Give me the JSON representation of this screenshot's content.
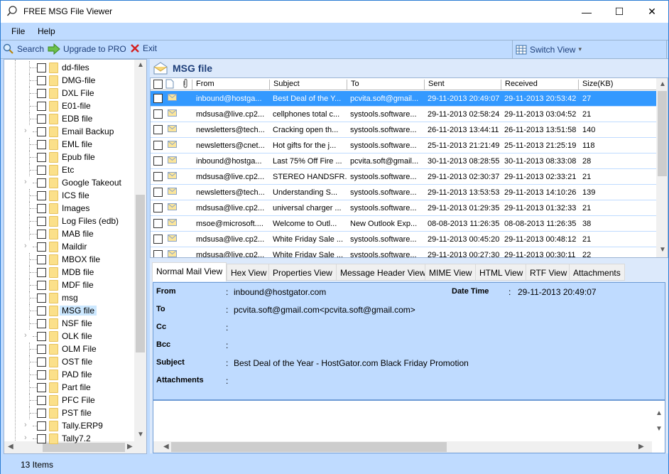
{
  "window": {
    "title": "FREE MSG File Viewer",
    "controls": {
      "minimize": "—",
      "maximize": "☐",
      "close": "✕"
    }
  },
  "menu": {
    "file": "File",
    "help": "Help"
  },
  "toolbar": {
    "search": "Search",
    "upgrade": "Upgrade to PRO",
    "exit": "Exit",
    "switch_view": "Switch View",
    "switch_view_caret": "▾"
  },
  "tree": {
    "items": [
      {
        "label": "dd-files",
        "expandable": false
      },
      {
        "label": "DMG-file",
        "expandable": false
      },
      {
        "label": "DXL File",
        "expandable": false
      },
      {
        "label": "E01-file",
        "expandable": false
      },
      {
        "label": "EDB file",
        "expandable": false
      },
      {
        "label": "Email Backup",
        "expandable": true
      },
      {
        "label": "EML file",
        "expandable": false
      },
      {
        "label": "Epub file",
        "expandable": false
      },
      {
        "label": "Etc",
        "expandable": false
      },
      {
        "label": "Google Takeout",
        "expandable": true
      },
      {
        "label": "ICS file",
        "expandable": false
      },
      {
        "label": "Images",
        "expandable": false
      },
      {
        "label": "Log Files (edb)",
        "expandable": false
      },
      {
        "label": "MAB file",
        "expandable": false
      },
      {
        "label": "Maildir",
        "expandable": true
      },
      {
        "label": "MBOX file",
        "expandable": false
      },
      {
        "label": "MDB file",
        "expandable": false
      },
      {
        "label": "MDF file",
        "expandable": false
      },
      {
        "label": "msg",
        "expandable": false
      },
      {
        "label": "MSG file",
        "expandable": false,
        "selected": true
      },
      {
        "label": "NSF file",
        "expandable": false
      },
      {
        "label": "OLK file",
        "expandable": true
      },
      {
        "label": "OLM File",
        "expandable": false
      },
      {
        "label": "OST file",
        "expandable": false
      },
      {
        "label": "PAD file",
        "expandable": false
      },
      {
        "label": "Part file",
        "expandable": false
      },
      {
        "label": "PFC File",
        "expandable": false
      },
      {
        "label": "PST file",
        "expandable": false
      },
      {
        "label": "Tally.ERP9",
        "expandable": true
      },
      {
        "label": "Tally7.2",
        "expandable": true
      }
    ]
  },
  "folder_header": {
    "title": "MSG file"
  },
  "grid": {
    "columns": [
      "From",
      "Subject",
      "To",
      "Sent",
      "Received",
      "Size(KB)"
    ],
    "rows": [
      {
        "from": "inbound@hostga...",
        "subject": "Best Deal of the Y...",
        "to": "pcvita.soft@gmail...",
        "sent": "29-11-2013 20:49:07",
        "received": "29-11-2013 20:53:42",
        "size": "27",
        "selected": true
      },
      {
        "from": "mdsusa@live.cp2...",
        "subject": "cellphones total c...",
        "to": "systools.software...",
        "sent": "29-11-2013 02:58:24",
        "received": "29-11-2013 03:04:52",
        "size": "21"
      },
      {
        "from": "newsletters@tech...",
        "subject": "Cracking open th...",
        "to": "systools.software...",
        "sent": "26-11-2013 13:44:11",
        "received": "26-11-2013 13:51:58",
        "size": "140"
      },
      {
        "from": "newsletters@cnet...",
        "subject": "Hot gifts for the j...",
        "to": "systools.software...",
        "sent": "25-11-2013 21:21:49",
        "received": "25-11-2013 21:25:19",
        "size": "118"
      },
      {
        "from": "inbound@hostga...",
        "subject": "Last 75% Off Fire ...",
        "to": "pcvita.soft@gmail...",
        "sent": "30-11-2013 08:28:55",
        "received": "30-11-2013 08:33:08",
        "size": "28"
      },
      {
        "from": "mdsusa@live.cp2...",
        "subject": "STEREO HANDSFR...",
        "to": "systools.software...",
        "sent": "29-11-2013 02:30:37",
        "received": "29-11-2013 02:33:21",
        "size": "21"
      },
      {
        "from": "newsletters@tech...",
        "subject": "Understanding S...",
        "to": "systools.software...",
        "sent": "29-11-2013 13:53:53",
        "received": "29-11-2013 14:10:26",
        "size": "139"
      },
      {
        "from": "mdsusa@live.cp2...",
        "subject": "universal charger ...",
        "to": "systools.software...",
        "sent": "29-11-2013 01:29:35",
        "received": "29-11-2013 01:32:33",
        "size": "21"
      },
      {
        "from": "msoe@microsoft....",
        "subject": "Welcome to Outl...",
        "to": "New Outlook Exp...",
        "sent": "08-08-2013 11:26:35",
        "received": "08-08-2013 11:26:35",
        "size": "38"
      },
      {
        "from": "mdsusa@live.cp2...",
        "subject": "White Friday Sale ...",
        "to": "systools.software...",
        "sent": "29-11-2013 00:45:20",
        "received": "29-11-2013 00:48:12",
        "size": "21"
      },
      {
        "from": "mdsusa@live.cp2...",
        "subject": "White Friday Sale ...",
        "to": "systools.software...",
        "sent": "29-11-2013 00:27:30",
        "received": "29-11-2013 00:30:11",
        "size": "22"
      }
    ]
  },
  "tabs": [
    "Normal Mail View",
    "Hex View",
    "Properties View",
    "Message Header View",
    "MIME View",
    "HTML View",
    "RTF View",
    "Attachments"
  ],
  "active_tab": "Normal Mail View",
  "details": {
    "from_label": "From",
    "from": "inbound@hostgator.com",
    "datetime_label": "Date Time",
    "datetime": "29-11-2013 20:49:07",
    "to_label": "To",
    "to": "pcvita.soft@gmail.com<pcvita.soft@gmail.com>",
    "cc_label": "Cc",
    "cc": "",
    "bcc_label": "Bcc",
    "bcc": "",
    "subject_label": "Subject",
    "subject": "Best Deal of the Year - HostGator.com Black Friday Promotion",
    "attachments_label": "Attachments",
    "attachments": "",
    "colon": ":"
  },
  "status": {
    "text": "13 Items"
  }
}
